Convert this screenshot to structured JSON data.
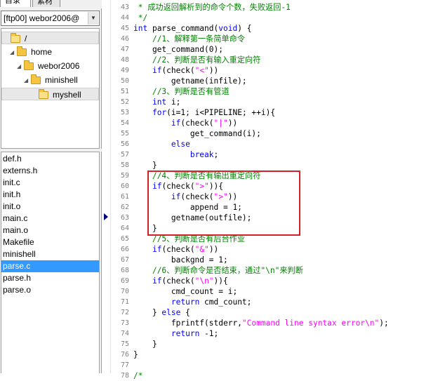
{
  "tabs": [
    "目录",
    "素材"
  ],
  "server_selector": "[ftp00] webor2006@",
  "tree": [
    {
      "label": "/",
      "depth": 0,
      "expander": "",
      "selected": true
    },
    {
      "label": "home",
      "depth": 1,
      "expander": "◢",
      "selected": false
    },
    {
      "label": "webor2006",
      "depth": 2,
      "expander": "◢",
      "selected": false
    },
    {
      "label": "minishell",
      "depth": 3,
      "expander": "◢",
      "selected": false
    },
    {
      "label": "myshell",
      "depth": 4,
      "expander": "",
      "selected": true
    }
  ],
  "files": [
    "def.h",
    "externs.h",
    "init.c",
    "init.h",
    "init.o",
    "main.c",
    "main.o",
    "Makefile",
    "minishell",
    "parse.c",
    "parse.h",
    "parse.o"
  ],
  "selected_file": "parse.c",
  "colors": {
    "selection": "#3399ff",
    "keyword": "#0000ff",
    "comment": "#008000",
    "string": "#ff00ff",
    "highlight_box": "#d4202a"
  },
  "code": [
    {
      "n": "43",
      "t": [
        [
          "cm",
          " * 成功返回解析到的命令个数，失败返回-1"
        ]
      ]
    },
    {
      "n": "44",
      "t": [
        [
          "cm",
          " */"
        ]
      ]
    },
    {
      "n": "45",
      "t": [
        [
          "kw",
          "int"
        ],
        [
          "",
          " parse_command("
        ],
        [
          "kw",
          "void"
        ],
        [
          "",
          ") {"
        ]
      ]
    },
    {
      "n": "46",
      "t": [
        [
          "",
          "    "
        ],
        [
          "cm",
          "//1、解释第一条简单命令"
        ]
      ]
    },
    {
      "n": "47",
      "t": [
        [
          "",
          "    get_command(0);"
        ]
      ]
    },
    {
      "n": "48",
      "t": [
        [
          "",
          "    "
        ],
        [
          "cm",
          "//2、判断是否有输入重定向符"
        ]
      ]
    },
    {
      "n": "49",
      "t": [
        [
          "",
          "    "
        ],
        [
          "kw",
          "if"
        ],
        [
          "",
          "(check("
        ],
        [
          "st",
          "\"<\""
        ],
        [
          "",
          "))"
        ]
      ]
    },
    {
      "n": "50",
      "t": [
        [
          "",
          "        getname(infile);"
        ]
      ]
    },
    {
      "n": "51",
      "t": [
        [
          "",
          "    "
        ],
        [
          "cm",
          "//3、判断是否有管道"
        ]
      ]
    },
    {
      "n": "52",
      "t": [
        [
          "",
          "    "
        ],
        [
          "kw",
          "int"
        ],
        [
          "",
          " i;"
        ]
      ]
    },
    {
      "n": "53",
      "t": [
        [
          "",
          "    "
        ],
        [
          "kw",
          "for"
        ],
        [
          "",
          "(i=1; i<PIPELINE; ++i){"
        ]
      ]
    },
    {
      "n": "54",
      "t": [
        [
          "",
          "        "
        ],
        [
          "kw",
          "if"
        ],
        [
          "",
          "(check("
        ],
        [
          "st",
          "\"|\""
        ],
        [
          "",
          "))"
        ]
      ]
    },
    {
      "n": "55",
      "t": [
        [
          "",
          "            get_command(i);"
        ]
      ]
    },
    {
      "n": "56",
      "t": [
        [
          "",
          "        "
        ],
        [
          "kw",
          "else"
        ]
      ]
    },
    {
      "n": "57",
      "t": [
        [
          "",
          "            "
        ],
        [
          "kw",
          "break"
        ],
        [
          "",
          ";"
        ]
      ]
    },
    {
      "n": "58",
      "t": [
        [
          "",
          "    }"
        ]
      ]
    },
    {
      "n": "59",
      "t": [
        [
          "",
          "    "
        ],
        [
          "cm",
          "//4、判断是否有输出重定向符"
        ]
      ]
    },
    {
      "n": "60",
      "t": [
        [
          "",
          "    "
        ],
        [
          "kw",
          "if"
        ],
        [
          "",
          "(check("
        ],
        [
          "st",
          "\">\""
        ],
        [
          "",
          ")){"
        ]
      ]
    },
    {
      "n": "61",
      "t": [
        [
          "",
          "        "
        ],
        [
          "kw",
          "if"
        ],
        [
          "",
          "(check("
        ],
        [
          "st",
          "\">\""
        ],
        [
          "",
          "))"
        ]
      ]
    },
    {
      "n": "62",
      "t": [
        [
          "",
          "            append = 1;"
        ]
      ]
    },
    {
      "n": "63",
      "t": [
        [
          "",
          "        getname(outfile);"
        ]
      ]
    },
    {
      "n": "64",
      "t": [
        [
          "",
          "    }"
        ]
      ]
    },
    {
      "n": "65",
      "t": [
        [
          "",
          "    "
        ],
        [
          "cm",
          "//5、判断是否有后台作业"
        ]
      ]
    },
    {
      "n": "66",
      "t": [
        [
          "",
          "    "
        ],
        [
          "kw",
          "if"
        ],
        [
          "",
          "(check("
        ],
        [
          "st",
          "\"&\""
        ],
        [
          "",
          "))"
        ]
      ]
    },
    {
      "n": "67",
      "t": [
        [
          "",
          "        backgnd = 1;"
        ]
      ]
    },
    {
      "n": "68",
      "t": [
        [
          "",
          "    "
        ],
        [
          "cm",
          "//6、判断命令是否结束，通过\"\\n\"来判断"
        ]
      ]
    },
    {
      "n": "69",
      "t": [
        [
          "",
          "    "
        ],
        [
          "kw",
          "if"
        ],
        [
          "",
          "(check("
        ],
        [
          "st",
          "\"\\n\""
        ],
        [
          "",
          ")){"
        ]
      ]
    },
    {
      "n": "70",
      "t": [
        [
          "",
          "        cmd_count = i;"
        ]
      ]
    },
    {
      "n": "71",
      "t": [
        [
          "",
          "        "
        ],
        [
          "kw",
          "return"
        ],
        [
          "",
          " cmd_count;"
        ]
      ]
    },
    {
      "n": "72",
      "t": [
        [
          "",
          "    } "
        ],
        [
          "kw",
          "else"
        ],
        [
          "",
          " {"
        ]
      ]
    },
    {
      "n": "73",
      "t": [
        [
          "",
          "        fprintf(stderr,"
        ],
        [
          "st",
          "\"Command line syntax error\\n\""
        ],
        [
          "",
          ");"
        ]
      ]
    },
    {
      "n": "74",
      "t": [
        [
          "",
          "        "
        ],
        [
          "kw",
          "return"
        ],
        [
          "",
          " -1;"
        ]
      ]
    },
    {
      "n": "75",
      "t": [
        [
          "",
          "    }"
        ]
      ]
    },
    {
      "n": "76",
      "t": [
        [
          "",
          "}"
        ]
      ]
    },
    {
      "n": "77",
      "t": [
        [
          "",
          ""
        ]
      ]
    },
    {
      "n": "78",
      "t": [
        [
          "cm",
          "/*"
        ]
      ]
    }
  ]
}
